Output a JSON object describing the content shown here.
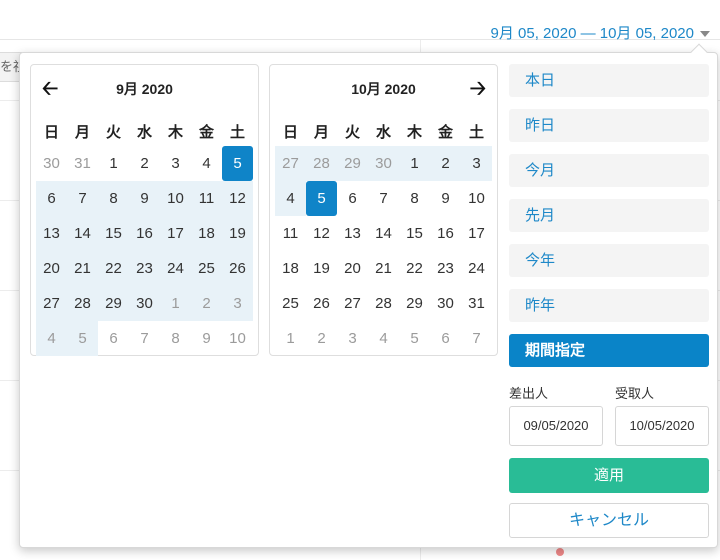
{
  "background": {
    "left_tab_text": "を視"
  },
  "range_trigger": {
    "label": "9月 05, 2020 — 10月 05, 2020",
    "caret_icon": "caret-down-icon"
  },
  "calendars": [
    {
      "title": "9月 2020",
      "weekdays": [
        "日",
        "月",
        "火",
        "水",
        "木",
        "金",
        "土"
      ],
      "weeks": [
        [
          {
            "d": "30",
            "s": "off"
          },
          {
            "d": "31",
            "s": "off"
          },
          {
            "d": "1",
            "s": ""
          },
          {
            "d": "2",
            "s": ""
          },
          {
            "d": "3",
            "s": ""
          },
          {
            "d": "4",
            "s": ""
          },
          {
            "d": "5",
            "s": "sel"
          }
        ],
        [
          {
            "d": "6",
            "s": "inr"
          },
          {
            "d": "7",
            "s": "inr"
          },
          {
            "d": "8",
            "s": "inr"
          },
          {
            "d": "9",
            "s": "inr"
          },
          {
            "d": "10",
            "s": "inr"
          },
          {
            "d": "11",
            "s": "inr"
          },
          {
            "d": "12",
            "s": "inr"
          }
        ],
        [
          {
            "d": "13",
            "s": "inr"
          },
          {
            "d": "14",
            "s": "inr"
          },
          {
            "d": "15",
            "s": "inr"
          },
          {
            "d": "16",
            "s": "inr"
          },
          {
            "d": "17",
            "s": "inr"
          },
          {
            "d": "18",
            "s": "inr"
          },
          {
            "d": "19",
            "s": "inr"
          }
        ],
        [
          {
            "d": "20",
            "s": "inr"
          },
          {
            "d": "21",
            "s": "inr"
          },
          {
            "d": "22",
            "s": "inr"
          },
          {
            "d": "23",
            "s": "inr"
          },
          {
            "d": "24",
            "s": "inr"
          },
          {
            "d": "25",
            "s": "inr"
          },
          {
            "d": "26",
            "s": "inr"
          }
        ],
        [
          {
            "d": "27",
            "s": "inr"
          },
          {
            "d": "28",
            "s": "inr"
          },
          {
            "d": "29",
            "s": "inr"
          },
          {
            "d": "30",
            "s": "inr"
          },
          {
            "d": "1",
            "s": "inr off"
          },
          {
            "d": "2",
            "s": "inr off"
          },
          {
            "d": "3",
            "s": "inr off"
          }
        ],
        [
          {
            "d": "4",
            "s": "inr off"
          },
          {
            "d": "5",
            "s": "inr off"
          },
          {
            "d": "6",
            "s": "off"
          },
          {
            "d": "7",
            "s": "off"
          },
          {
            "d": "8",
            "s": "off"
          },
          {
            "d": "9",
            "s": "off"
          },
          {
            "d": "10",
            "s": "off"
          }
        ]
      ]
    },
    {
      "title": "10月 2020",
      "weekdays": [
        "日",
        "月",
        "火",
        "水",
        "木",
        "金",
        "土"
      ],
      "weeks": [
        [
          {
            "d": "27",
            "s": "inr off"
          },
          {
            "d": "28",
            "s": "inr off"
          },
          {
            "d": "29",
            "s": "inr off"
          },
          {
            "d": "30",
            "s": "inr off"
          },
          {
            "d": "1",
            "s": "inr"
          },
          {
            "d": "2",
            "s": "inr"
          },
          {
            "d": "3",
            "s": "inr"
          }
        ],
        [
          {
            "d": "4",
            "s": "inr"
          },
          {
            "d": "5",
            "s": "sel"
          },
          {
            "d": "6",
            "s": ""
          },
          {
            "d": "7",
            "s": ""
          },
          {
            "d": "8",
            "s": ""
          },
          {
            "d": "9",
            "s": ""
          },
          {
            "d": "10",
            "s": ""
          }
        ],
        [
          {
            "d": "11",
            "s": ""
          },
          {
            "d": "12",
            "s": ""
          },
          {
            "d": "13",
            "s": ""
          },
          {
            "d": "14",
            "s": ""
          },
          {
            "d": "15",
            "s": ""
          },
          {
            "d": "16",
            "s": ""
          },
          {
            "d": "17",
            "s": ""
          }
        ],
        [
          {
            "d": "18",
            "s": ""
          },
          {
            "d": "19",
            "s": ""
          },
          {
            "d": "20",
            "s": ""
          },
          {
            "d": "21",
            "s": ""
          },
          {
            "d": "22",
            "s": ""
          },
          {
            "d": "23",
            "s": ""
          },
          {
            "d": "24",
            "s": ""
          }
        ],
        [
          {
            "d": "25",
            "s": ""
          },
          {
            "d": "26",
            "s": ""
          },
          {
            "d": "27",
            "s": ""
          },
          {
            "d": "28",
            "s": ""
          },
          {
            "d": "29",
            "s": ""
          },
          {
            "d": "30",
            "s": ""
          },
          {
            "d": "31",
            "s": ""
          }
        ],
        [
          {
            "d": "1",
            "s": "off"
          },
          {
            "d": "2",
            "s": "off"
          },
          {
            "d": "3",
            "s": "off"
          },
          {
            "d": "4",
            "s": "off"
          },
          {
            "d": "5",
            "s": "off"
          },
          {
            "d": "6",
            "s": "off"
          },
          {
            "d": "7",
            "s": "off"
          }
        ]
      ]
    }
  ],
  "nav": {
    "prev_icon": "arrow-left-icon",
    "next_icon": "arrow-right-icon"
  },
  "ranges": [
    {
      "label": "本日",
      "active": false
    },
    {
      "label": "昨日",
      "active": false
    },
    {
      "label": "今月",
      "active": false
    },
    {
      "label": "先月",
      "active": false
    },
    {
      "label": "今年",
      "active": false
    },
    {
      "label": "昨年",
      "active": false
    },
    {
      "label": "期間指定",
      "active": true
    }
  ],
  "inputs": {
    "start_label": "差出人",
    "end_label": "受取人",
    "start_value": "09/05/2020",
    "end_value": "10/05/2020"
  },
  "buttons": {
    "apply": "適用",
    "cancel": "キャンセル"
  },
  "colors": {
    "accent": "#0f84c8",
    "link": "#1e88c8",
    "apply": "#29bc96",
    "in_range": "#e8f2f8"
  }
}
